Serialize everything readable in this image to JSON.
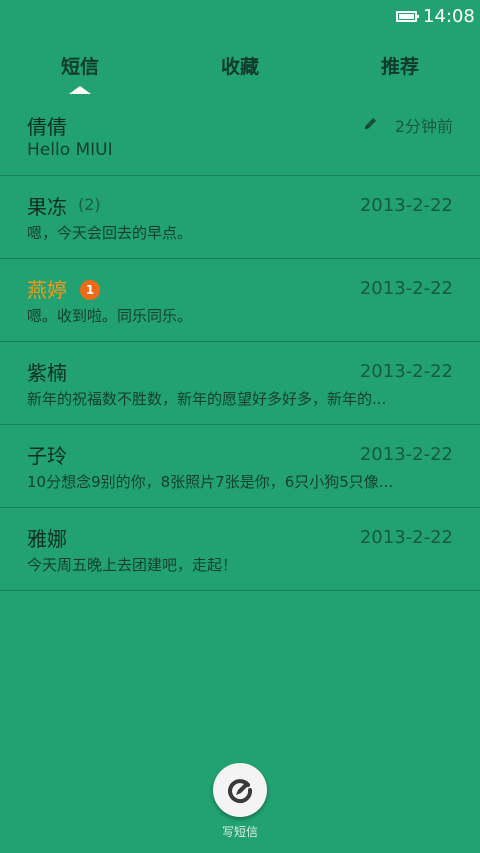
{
  "status_bar": {
    "time": "14:08"
  },
  "tabs": [
    {
      "label": "短信",
      "active": true
    },
    {
      "label": "收藏",
      "active": false
    },
    {
      "label": "推荐",
      "active": false
    }
  ],
  "conversations": [
    {
      "name": "倩倩",
      "count": "",
      "unread_badge": "",
      "date": "2分钟前",
      "draft": true,
      "preview": "Hello MIUI"
    },
    {
      "name": "果冻",
      "count": "(2)",
      "unread_badge": "",
      "date": "2013-2-22",
      "draft": false,
      "preview": "嗯，今天会回去的早点。"
    },
    {
      "name": "燕婷",
      "count": "",
      "unread_badge": "1",
      "date": "2013-2-22",
      "draft": false,
      "preview": "嗯。收到啦。同乐同乐。"
    },
    {
      "name": "紫楠",
      "count": "",
      "unread_badge": "",
      "date": "2013-2-22",
      "draft": false,
      "preview": "新年的祝福数不胜数，新年的愿望好多好多，新年的..."
    },
    {
      "name": "子玲",
      "count": "",
      "unread_badge": "",
      "date": "2013-2-22",
      "draft": false,
      "preview": "10分想念9别的你，8张照片7张是你，6只小狗5只像..."
    },
    {
      "name": "雅娜",
      "count": "",
      "unread_badge": "",
      "date": "2013-2-22",
      "draft": false,
      "preview": "今天周五晚上去团建吧，走起！"
    }
  ],
  "compose": {
    "label": "写短信",
    "icon": "compose-icon"
  },
  "colors": {
    "background": "#22a273",
    "unread_name": "#f19a14",
    "badge": "#ef6a17"
  }
}
